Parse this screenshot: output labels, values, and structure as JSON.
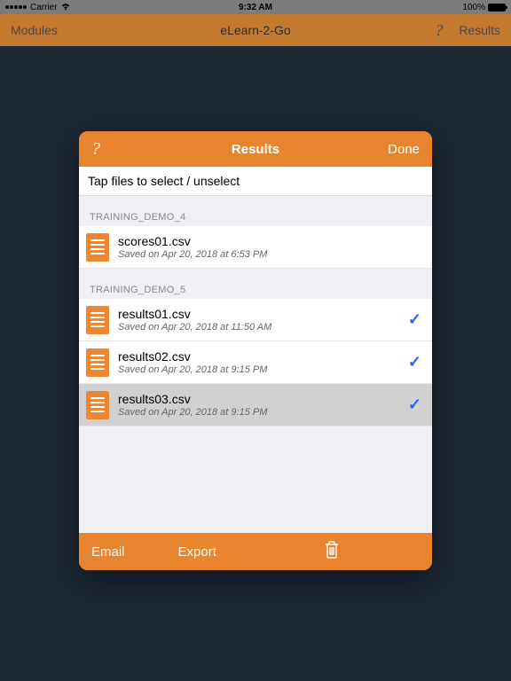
{
  "status": {
    "carrier": "Carrier",
    "time": "9:32 AM",
    "battery": "100%"
  },
  "nav": {
    "left": "Modules",
    "title": "eLearn-2-Go",
    "right": "Results"
  },
  "modal": {
    "title": "Results",
    "done": "Done",
    "instruction": "Tap files to select / unselect"
  },
  "sections": [
    {
      "header": "TRAINING_DEMO_4",
      "files": [
        {
          "name": "scores01.csv",
          "meta": "Saved on Apr 20, 2018 at 6:53 PM",
          "checked": false,
          "selected": false
        }
      ]
    },
    {
      "header": "TRAINING_DEMO_5",
      "files": [
        {
          "name": "results01.csv",
          "meta": "Saved on Apr 20, 2018 at 11:50 AM",
          "checked": true,
          "selected": false
        },
        {
          "name": "results02.csv",
          "meta": "Saved on Apr 20, 2018 at 9:15 PM",
          "checked": true,
          "selected": false
        },
        {
          "name": "results03.csv",
          "meta": "Saved on Apr 20, 2018 at 9:15 PM",
          "checked": true,
          "selected": true
        }
      ]
    }
  ],
  "toolbar": {
    "email": "Email",
    "export": "Export"
  }
}
